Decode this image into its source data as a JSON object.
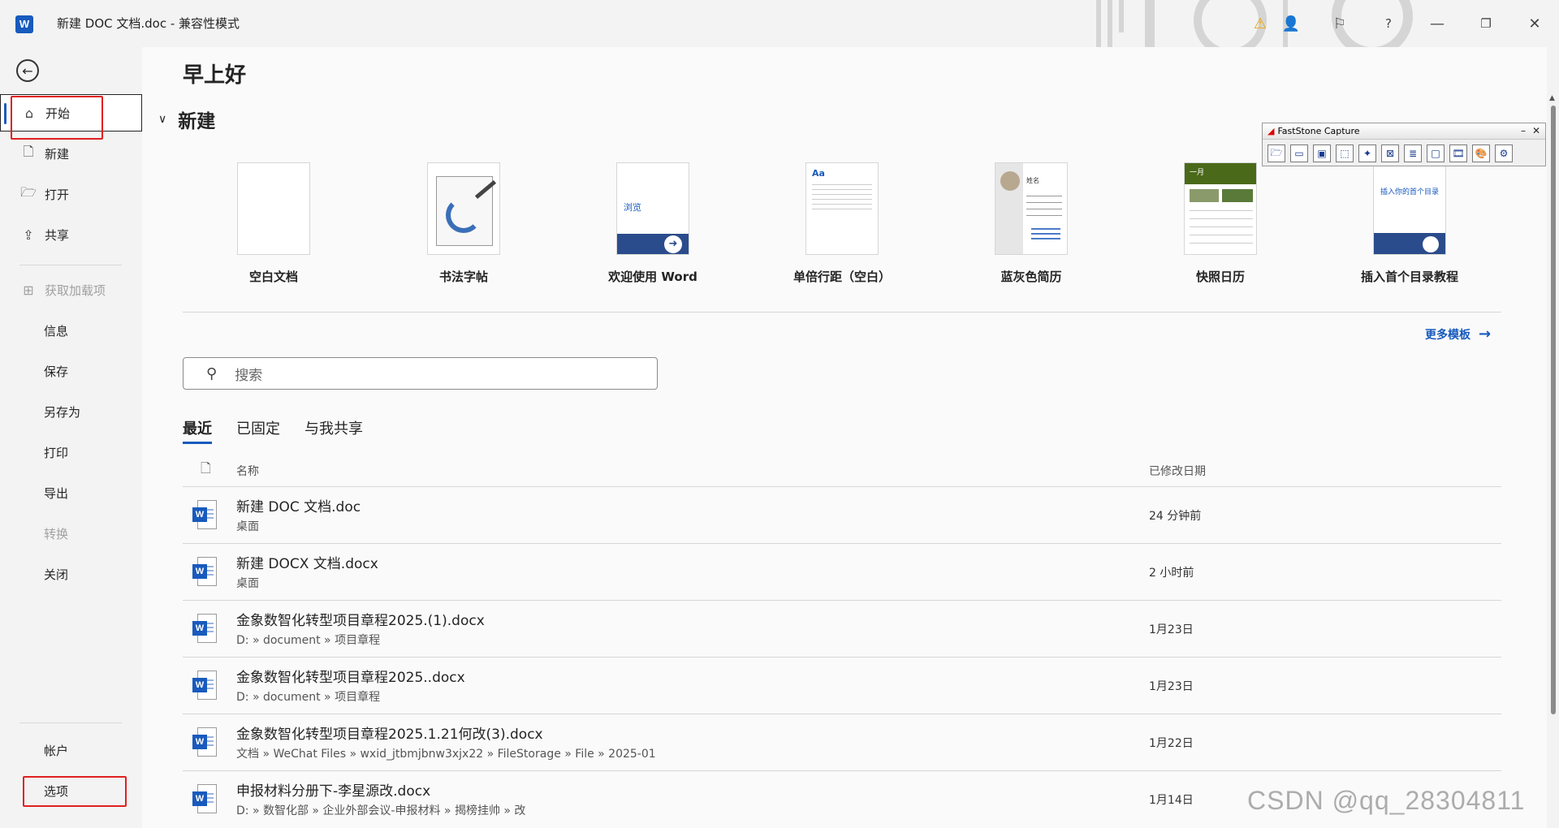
{
  "window": {
    "title": "新建 DOC 文档.doc  -  兼容性模式",
    "app_icon": "W"
  },
  "sidebar": {
    "items": [
      {
        "label": "开始",
        "icon": "home-icon"
      },
      {
        "label": "新建",
        "icon": "new-doc-icon"
      },
      {
        "label": "打开",
        "icon": "folder-open-icon"
      },
      {
        "label": "共享",
        "icon": "share-icon"
      },
      {
        "label": "获取加载项",
        "icon": "add-ins-icon"
      },
      {
        "label": "信息"
      },
      {
        "label": "保存"
      },
      {
        "label": "另存为"
      },
      {
        "label": "打印"
      },
      {
        "label": "导出"
      },
      {
        "label": "转换"
      },
      {
        "label": "关闭"
      },
      {
        "label": "帐户"
      },
      {
        "label": "选项"
      }
    ]
  },
  "main": {
    "greeting": "早上好",
    "new_section": "新建",
    "templates": [
      {
        "name": "空白文档"
      },
      {
        "name": "书法字帖"
      },
      {
        "name": "欢迎使用 Word",
        "thumb_text": "浏览"
      },
      {
        "name": "单倍行距（空白）",
        "thumb_text": "Aa"
      },
      {
        "name": "蓝灰色简历",
        "thumb_text": "姓名"
      },
      {
        "name": "快照日历",
        "thumb_text": "一月"
      },
      {
        "name": "插入首个目录教程",
        "thumb_text": "插入你的首个目录"
      }
    ],
    "more_templates": "更多模板",
    "search_placeholder": "搜索",
    "tabs": [
      "最近",
      "已固定",
      "与我共享"
    ],
    "list_header": {
      "name": "名称",
      "date": "已修改日期"
    },
    "files": [
      {
        "name": "新建 DOC 文档.doc",
        "path": "桌面",
        "date": "24 分钟前"
      },
      {
        "name": "新建 DOCX 文档.docx",
        "path": "桌面",
        "date": "2 小时前"
      },
      {
        "name": "金象数智化转型项目章程2025.(1).docx",
        "path": "D: » document » 项目章程",
        "date": "1月23日"
      },
      {
        "name": "金象数智化转型项目章程2025..docx",
        "path": "D: » document » 项目章程",
        "date": "1月23日"
      },
      {
        "name": "金象数智化转型项目章程2025.1.21何改(3).docx",
        "path": "文档 » WeChat Files » wxid_jtbmjbnw3xjx22 » FileStorage » File » 2025-01",
        "date": "1月22日"
      },
      {
        "name": "申报材料分册下-李星源改.docx",
        "path": "D: » 数智化部 » 企业外部会议-申报材料 » 揭榜挂帅 » 改",
        "date": "1月14日"
      }
    ]
  },
  "faststone": {
    "title": "FastStone Capture"
  },
  "watermark": "CSDN @qq_28304811",
  "colors": {
    "accent": "#185abd",
    "highlight_box": "#e02020"
  }
}
